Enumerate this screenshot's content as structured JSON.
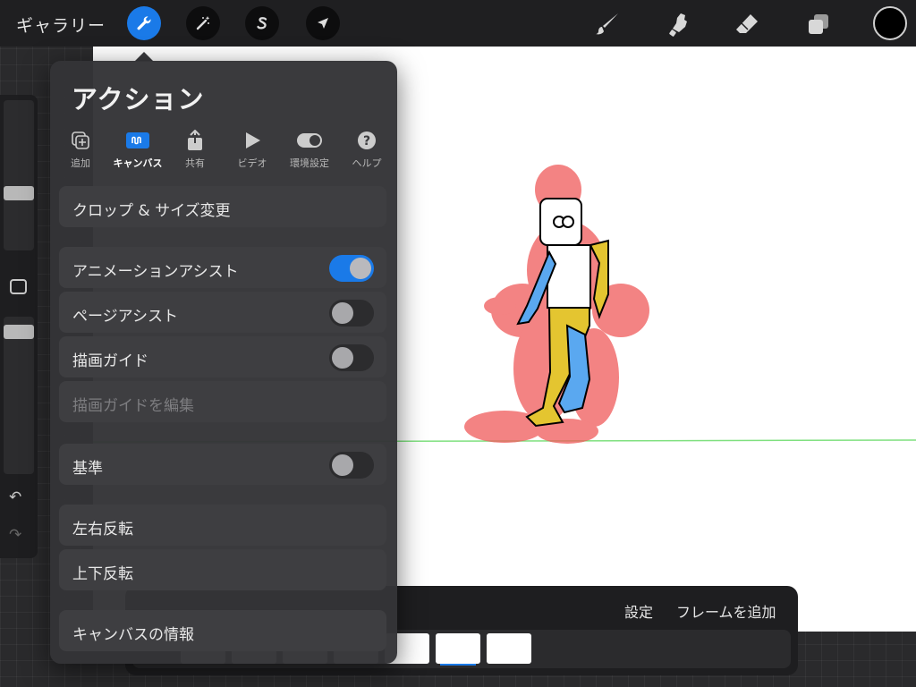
{
  "topbar": {
    "gallery_label": "ギャラリー",
    "tools_left": [
      "wrench-icon",
      "magic-wand-icon",
      "selection-s-icon",
      "transform-arrow-icon"
    ],
    "tools_right": [
      "brush-icon",
      "smudge-icon",
      "eraser-icon",
      "layers-icon"
    ],
    "current_color": "#000000"
  },
  "actions_panel": {
    "title": "アクション",
    "tabs": [
      {
        "label": "追加",
        "icon": "add-icon"
      },
      {
        "label": "キャンバス",
        "icon": "canvas-icon",
        "active": true
      },
      {
        "label": "共有",
        "icon": "share-icon"
      },
      {
        "label": "ビデオ",
        "icon": "video-play-icon"
      },
      {
        "label": "環境設定",
        "icon": "preferences-toggle-icon"
      },
      {
        "label": "ヘルプ",
        "icon": "help-icon"
      }
    ],
    "items": {
      "crop_resize": "クロップ & サイズ変更",
      "animation_assist": {
        "label": "アニメーションアシスト",
        "on": true
      },
      "page_assist": {
        "label": "ページアシスト",
        "on": false
      },
      "drawing_guide": {
        "label": "描画ガイド",
        "on": false
      },
      "edit_drawing_guide": "描画ガイドを編集",
      "reference": {
        "label": "基準",
        "on": false
      },
      "flip_horizontal": "左右反転",
      "flip_vertical": "上下反転",
      "canvas_info": "キャンバスの情報"
    }
  },
  "timeline": {
    "settings_label": "設定",
    "add_frame_label": "フレームを追加"
  },
  "colors": {
    "accent": "#1a7ae8",
    "panel_bg": "#343437",
    "row_bg": "#3e3e41"
  }
}
